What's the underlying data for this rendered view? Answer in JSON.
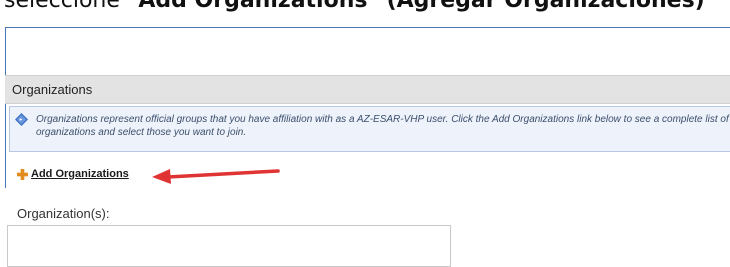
{
  "caption": {
    "prefix": "seleccione ",
    "bold": "\"Add Organizations\" (Agregar Organizaciones)"
  },
  "section": {
    "header": "Organizations",
    "info_text": "Organizations represent official groups that you have affiliation with as a AZ-ESAR-VHP user. Click the Add Organizations link below to see a complete list of organizations and select those you want to join.",
    "add_link": "Add Organizations"
  },
  "field": {
    "label": "Organization(s):",
    "value": ""
  },
  "icons": [
    "info-diamond-icon",
    "plus-icon",
    "red-arrow-icon"
  ],
  "colors": {
    "accent_border": "#4b76b8",
    "info_bg": "#edf2fb",
    "header_bg": "#e3e3e3",
    "arrow": "#e03434",
    "plus": "#e48b1f"
  }
}
